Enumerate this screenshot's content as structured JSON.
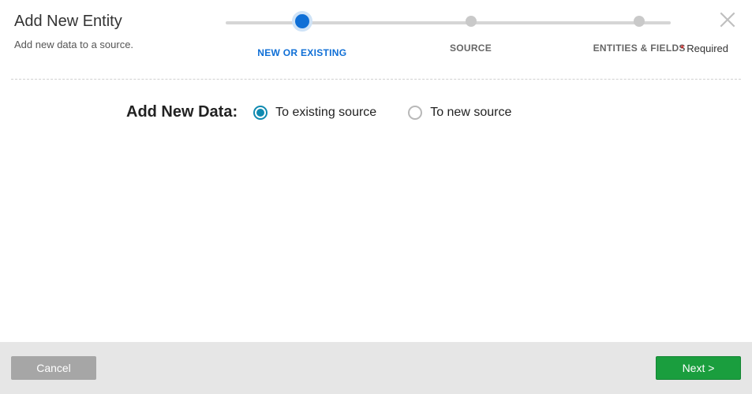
{
  "header": {
    "title": "Add New Entity",
    "subtitle": "Add new data to a source."
  },
  "stepper": {
    "steps": [
      {
        "label": "NEW OR EXISTING",
        "active": true
      },
      {
        "label": "SOURCE",
        "active": false
      },
      {
        "label": "ENTITIES & FIELDS",
        "active": false
      }
    ]
  },
  "required_label": "Required",
  "form": {
    "label": "Add New Data:",
    "options": [
      {
        "label": "To existing source",
        "selected": true
      },
      {
        "label": "To new source",
        "selected": false
      }
    ]
  },
  "footer": {
    "cancel": "Cancel",
    "next": "Next >"
  }
}
